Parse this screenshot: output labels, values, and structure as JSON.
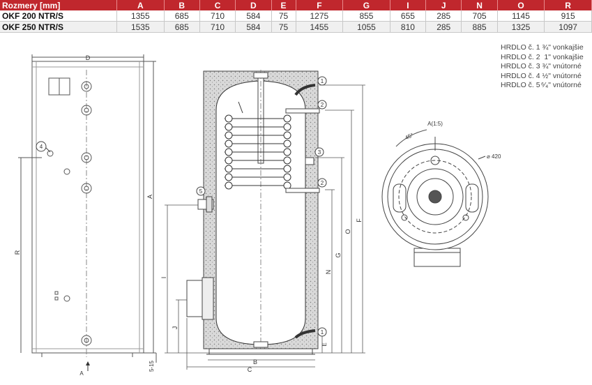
{
  "table": {
    "header_label": "Rozmery [mm]",
    "columns": [
      "A",
      "B",
      "C",
      "D",
      "E",
      "F",
      "G",
      "I",
      "J",
      "N",
      "O",
      "R"
    ],
    "rows": [
      {
        "model": "OKF 200 NTR/S",
        "values": [
          "1355",
          "685",
          "710",
          "584",
          "75",
          "1275",
          "855",
          "655",
          "285",
          "705",
          "1145",
          "915"
        ]
      },
      {
        "model": "OKF 250 NTR/S",
        "values": [
          "1535",
          "685",
          "710",
          "584",
          "75",
          "1455",
          "1055",
          "810",
          "285",
          "885",
          "1325",
          "1097"
        ]
      }
    ]
  },
  "legend": [
    {
      "name": "HRDLO č. 1",
      "size": "¾\"",
      "type": "vonkajšie"
    },
    {
      "name": "HRDLO č. 2",
      "size": "1\"",
      "type": "vonkajšie"
    },
    {
      "name": "HRDLO č. 3",
      "size": "¾\"",
      "type": "vnútorné"
    },
    {
      "name": "HRDLO č. 4",
      "size": "½\"",
      "type": "vnútorné"
    },
    {
      "name": "HRDLO č. 5",
      "size": "⁶⁄₄\"",
      "type": "vnútorné"
    }
  ],
  "drawing": {
    "side_view": {
      "dim_d": "D",
      "dim_a": "A",
      "dim_r": "R",
      "arrow_label": "A",
      "dim_515": "5-15",
      "port_4": "4"
    },
    "section_view": {
      "dim_b": "B",
      "dim_c": "C",
      "dim_f": "F",
      "dim_o": "O",
      "dim_g": "G",
      "dim_n": "N",
      "dim_i": "I",
      "dim_j": "J",
      "dim_e": "E",
      "port_1a": "1",
      "port_2a": "2",
      "port_3": "3",
      "port_2b": "2",
      "port_1b": "1",
      "port_5": "5"
    },
    "top_view": {
      "label": "A(1:5)",
      "angle": "45°",
      "diameter": "⌀ 420"
    }
  }
}
